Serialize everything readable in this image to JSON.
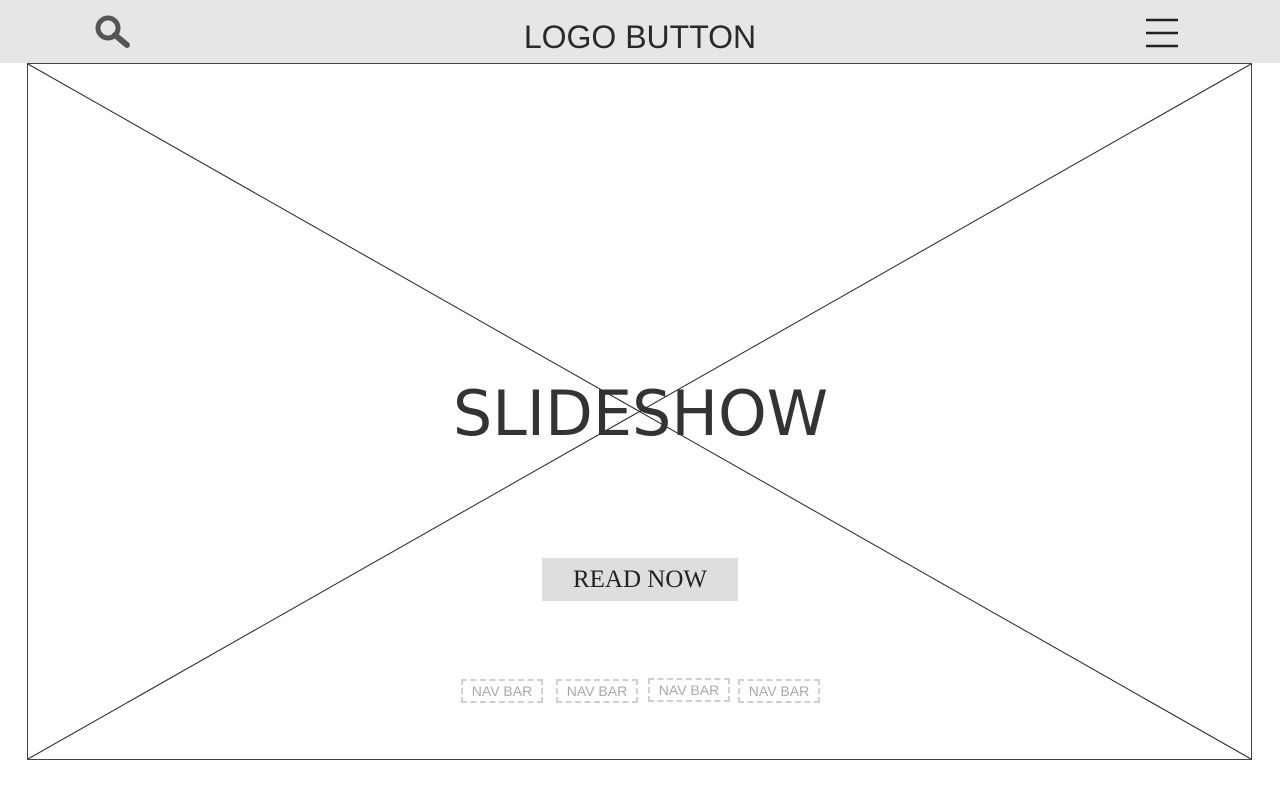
{
  "header": {
    "logo_label": "LOGO BUTTON",
    "search_icon": "search-icon",
    "menu_icon": "hamburger-menu-icon"
  },
  "slideshow": {
    "title": "SLIDESHOW",
    "read_button_label": "READ NOW",
    "nav_items": [
      "NAV BAR",
      "NAV BAR",
      "NAV BAR",
      "NAV BAR"
    ]
  },
  "colors": {
    "header_bg": "#e7e6e7",
    "button_bg": "#dedede",
    "text_dark": "#333333",
    "nav_text": "#a9a9a9"
  }
}
